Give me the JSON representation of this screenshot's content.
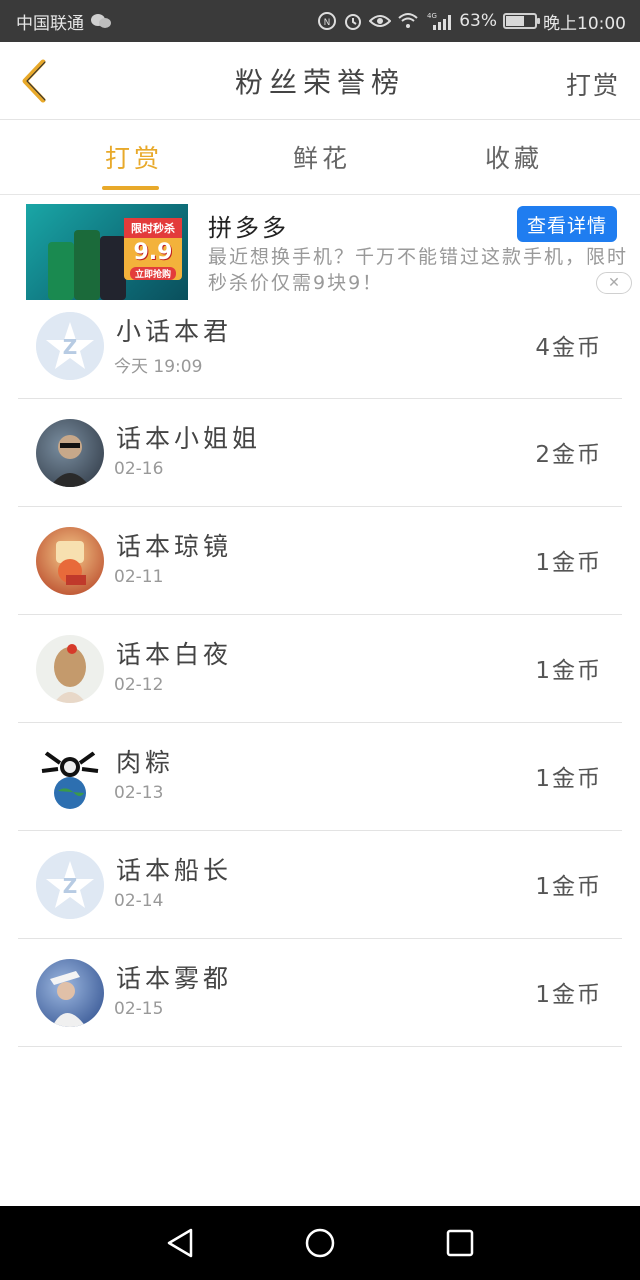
{
  "status_bar": {
    "carrier": "中国联通",
    "battery": "63%",
    "battery_level": 0.63,
    "network": "4G",
    "time": "晚上10:00"
  },
  "header": {
    "title": "粉丝荣誉榜",
    "right_action": "打赏"
  },
  "tabs": [
    {
      "label": "打赏",
      "active": true
    },
    {
      "label": "鲜花",
      "active": false
    },
    {
      "label": "收藏",
      "active": false
    }
  ],
  "ad": {
    "brand": "拼多多",
    "description": "最近想换手机？千万不能错过这款手机，限时秒杀价仅需9块9！",
    "cta": "查看详情",
    "badge_top": "限时秒杀",
    "badge_price": "9.9",
    "badge_button": "立即抢购"
  },
  "list": [
    {
      "name": "小话本君",
      "date": "今天 19:09",
      "coins": "4金币",
      "avatar": "default-z-avatar"
    },
    {
      "name": "话本小姐姐",
      "date": "02-16",
      "coins": "2金币",
      "avatar": "photo-avatar"
    },
    {
      "name": "话本琼镜",
      "date": "02-11",
      "coins": "1金币",
      "avatar": "photo-avatar"
    },
    {
      "name": "话本白夜",
      "date": "02-12",
      "coins": "1金币",
      "avatar": "photo-avatar"
    },
    {
      "name": "肉粽",
      "date": "02-13",
      "coins": "1金币",
      "avatar": "photo-avatar"
    },
    {
      "name": "话本船长",
      "date": "02-14",
      "coins": "1金币",
      "avatar": "default-z-avatar"
    },
    {
      "name": "话本雾都",
      "date": "02-15",
      "coins": "1金币",
      "avatar": "photo-avatar"
    }
  ],
  "colors": {
    "accent": "#e8a92a",
    "cta_blue": "#1f7df0",
    "status_bar_bg": "#3a3a3a",
    "nav_bar_bg": "#000000"
  }
}
